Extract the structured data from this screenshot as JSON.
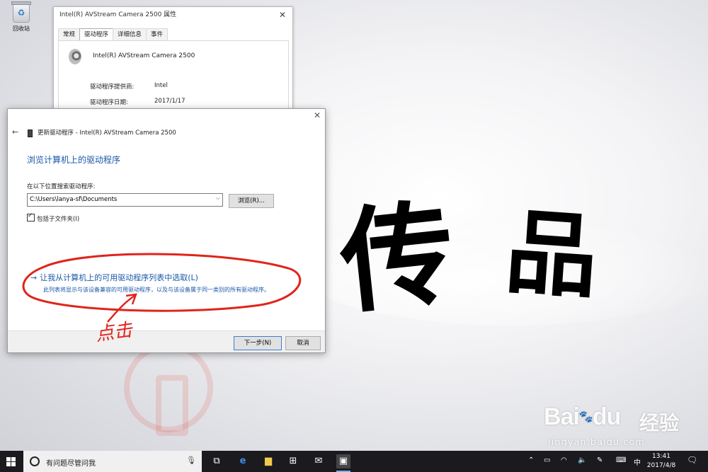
{
  "desktop": {
    "recycle_label": "回收站",
    "calligraphy": [
      "传",
      "品"
    ],
    "watermark_brand": "Bai",
    "watermark_du": "du",
    "watermark_cn": "经验",
    "watermark_url": "jingyan.baidu.com"
  },
  "properties_window": {
    "title": "Intel(R) AVStream Camera 2500 属性",
    "tabs": [
      "常规",
      "驱动程序",
      "详细信息",
      "事件"
    ],
    "active_tab": "驱动程序",
    "device_name": "Intel(R) AVStream Camera 2500",
    "rows": [
      {
        "label": "驱动程序提供商:",
        "value": "Intel"
      },
      {
        "label": "驱动程序日期:",
        "value": "2017/1/17"
      }
    ]
  },
  "update_dialog": {
    "header": "更新驱动程序 - Intel(R) AVStream Camera 2500",
    "heading": "浏览计算机上的驱动程序",
    "search_label": "在以下位置搜索驱动程序:",
    "path_value": "C:\\Users\\lanya-sf\\Documents",
    "browse_label": "浏览(R)...",
    "include_subfolders": "包括子文件夹(I)",
    "option_link": "让我从计算机上的可用驱动程序列表中选取(L)",
    "option_desc": "此列表将显示与该设备兼容的可用驱动程序，以及与该设备属于同一类别的所有驱动程序。",
    "next_label": "下一步(N)",
    "cancel_label": "取消"
  },
  "annotation": {
    "text": "点击",
    "color": "#e0241b"
  },
  "taskbar": {
    "search_placeholder": "有问题尽管问我",
    "ime": "中",
    "time": "13:41",
    "date": "2017/4/8"
  },
  "colors": {
    "link_blue": "#1a58a8",
    "taskbar": "#1b1b1f"
  }
}
